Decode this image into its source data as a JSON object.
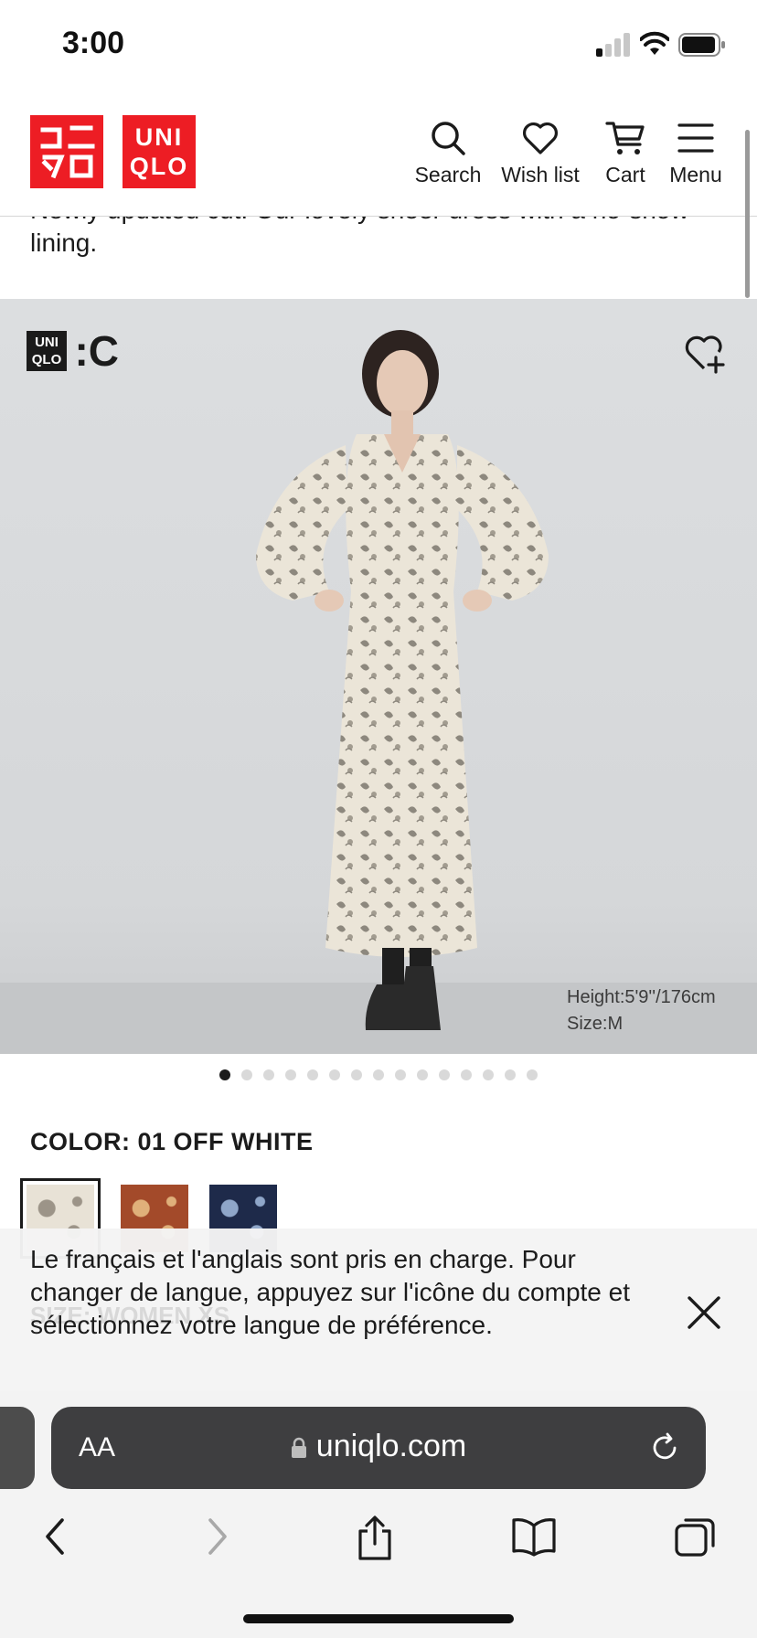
{
  "status_bar": {
    "time": "3:00"
  },
  "header": {
    "logo_left": [
      "ユニ",
      "クロ"
    ],
    "logo_right": [
      "UNI",
      "QLO"
    ],
    "nav": {
      "search": "Search",
      "wishlist": "Wish list",
      "cart": "Cart",
      "menu": "Menu"
    }
  },
  "description": "Newly updated cut. Our lovely sheer dress with a no-show lining.",
  "hero": {
    "collab_logo": [
      "UNI",
      "QLO",
      ":C"
    ],
    "model_height": "Height:5'9''/176cm",
    "model_size": "Size:M",
    "carousel_total": 15,
    "carousel_active": 1
  },
  "color": {
    "label": "COLOR: 01 OFF WHITE",
    "swatches": [
      {
        "name": "01 OFF WHITE",
        "color": "#e8e2d6",
        "pattern": "#9c9488",
        "selected": true
      },
      {
        "name": "BROWN",
        "color": "#a34a2a",
        "pattern": "#e0b07a",
        "selected": false
      },
      {
        "name": "NAVY",
        "color": "#1e2a4a",
        "pattern": "#8fa6c9",
        "selected": false
      }
    ]
  },
  "language_banner": {
    "text": "Le français et l'anglais sont pris en charge. Pour changer de langue, appuyez sur l'icône du compte et sélectionnez votre langue de préférence.",
    "ghost_text": "SIZE: WOMEN XS"
  },
  "browser": {
    "aa_label": "AA",
    "url": "uniqlo.com"
  },
  "colors": {
    "brand_red": "#ed1d24",
    "text": "#1b1b1b",
    "url_pill": "#3e3e40"
  }
}
